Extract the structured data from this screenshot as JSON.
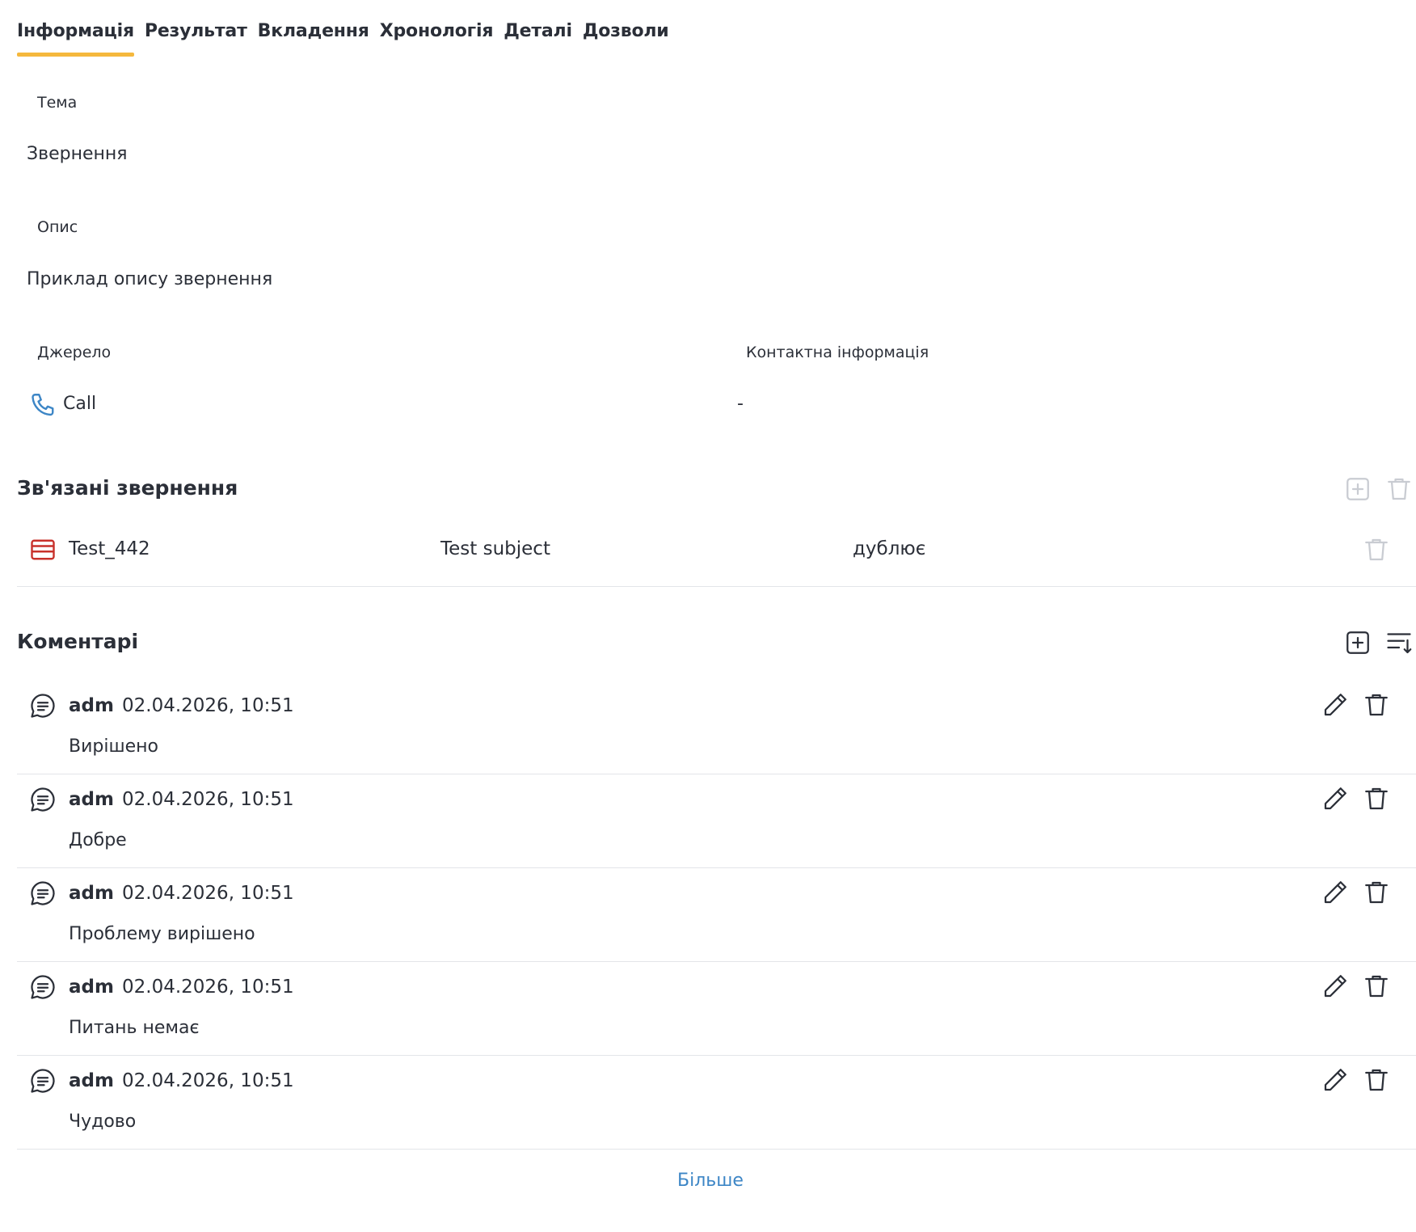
{
  "tabs": [
    {
      "label": "Інформація",
      "active": true
    },
    {
      "label": "Результат"
    },
    {
      "label": "Вкладення"
    },
    {
      "label": "Хронологія"
    },
    {
      "label": "Деталі"
    },
    {
      "label": "Дозволи"
    }
  ],
  "info": {
    "subject_label": "Тема",
    "subject_value": "Звернення",
    "description_label": "Опис",
    "description_value": "Приклад опису звернення",
    "source_label": "Джерело",
    "source_value": "Call",
    "contact_label": "Контактна інформація",
    "contact_value": "-"
  },
  "related": {
    "title": "Зв'язані звернення",
    "items": [
      {
        "id": "Test_442",
        "subject": "Test subject",
        "relation": "дублює"
      }
    ]
  },
  "comments": {
    "title": "Коментарі",
    "items": [
      {
        "author": "adm",
        "date": "02.04.2026, 10:51",
        "text": "Вирішено"
      },
      {
        "author": "adm",
        "date": "02.04.2026, 10:51",
        "text": "Добре"
      },
      {
        "author": "adm",
        "date": "02.04.2026, 10:51",
        "text": "Проблему вирішено"
      },
      {
        "author": "adm",
        "date": "02.04.2026, 10:51",
        "text": "Питань немає"
      },
      {
        "author": "adm",
        "date": "02.04.2026, 10:51",
        "text": "Чудово"
      }
    ],
    "more_label": "Більше"
  },
  "colors": {
    "accent": "#f5b83d",
    "link": "#3d86c6",
    "phone_icon": "#3d86c6",
    "case_icon": "#c8312b",
    "disabled_icon": "#c9ccd2",
    "text": "#2b2f38"
  }
}
